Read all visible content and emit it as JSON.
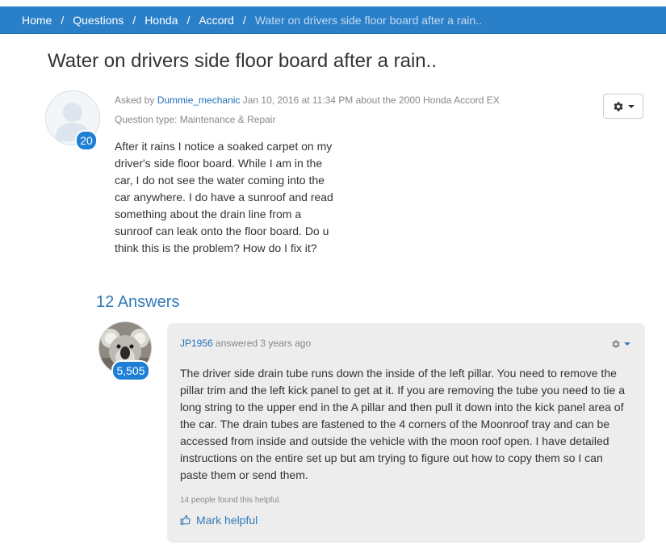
{
  "breadcrumb": {
    "items": [
      "Home",
      "Questions",
      "Honda",
      "Accord"
    ],
    "separator": "/",
    "current": "Water on drivers side floor board after a rain.."
  },
  "question": {
    "title": "Water on drivers side floor board after a rain..",
    "asked_by_prefix": "Asked by",
    "author": "Dummie_mechanic",
    "date_text": "Jan 10, 2016 at 11:34 PM about the 2000 Honda Accord EX",
    "type_text": "Question type: Maintenance & Repair",
    "author_points": "20",
    "body": "After it rains I notice a soaked carpet on my driver's side floor board. While I am in the car, I do not see the water coming into the car anywhere. I do have a sunroof and read something about the drain line from a sunroof can leak onto the floor board. Do u think this is the problem? How do I fix it?"
  },
  "answers": {
    "heading": "12 Answers",
    "items": [
      {
        "author": "JP1956",
        "meta_text": "answered 3 years ago",
        "author_points": "5,505",
        "body": "The driver side drain tube runs down the inside of the left pillar. You need to remove the pillar trim and the left kick panel to get at it. If you are removing the tube you need to tie a long string to the upper end in the A pillar and then pull it down into the kick panel area of the car. The drain tubes are fastened to the 4 corners of the Moonroof tray and can be accessed from inside and outside the vehicle with the moon roof open. I have detailed instructions on the entire set up but am trying to figure out how to copy them so I can paste them or send them.",
        "helpful_text": "14 people found this helpful.",
        "mark_helpful_label": "Mark helpful"
      }
    ]
  },
  "icons": {
    "settings": "gear-icon",
    "dropdown": "caret-down-icon",
    "thumbs_up": "thumbs-up-icon",
    "default_avatar": "user-silhouette-icon",
    "answer_avatar": "koala-avatar"
  },
  "colors": {
    "nav_bg": "#2a7fc9",
    "link": "#337ab7",
    "badge": "#1e7fd6",
    "card_bg": "#ededed"
  }
}
